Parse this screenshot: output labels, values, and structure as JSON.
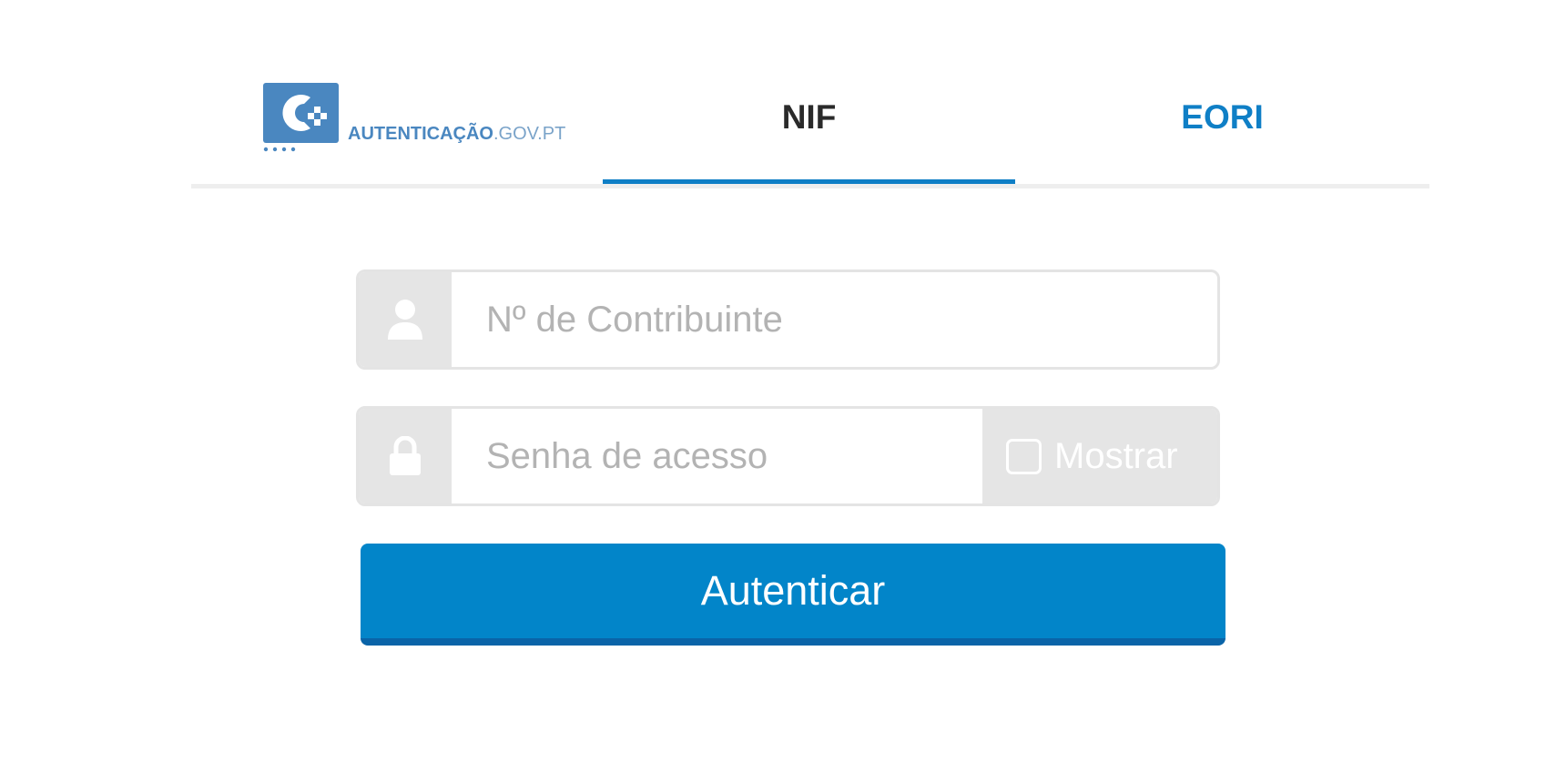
{
  "header": {
    "logo": {
      "brand_bold": "AUTENTICAÇÃO",
      "brand_thin": ".GOV.PT",
      "alt": "autenticacao-gov-logo"
    },
    "tabs": [
      {
        "label": "NIF",
        "active": true
      },
      {
        "label": "EORI",
        "active": false
      }
    ]
  },
  "form": {
    "nif_field": {
      "placeholder": "Nº de Contribuinte",
      "value": "",
      "icon": "user-icon"
    },
    "password_field": {
      "placeholder": "Senha de acesso",
      "value": "",
      "icon": "lock-icon"
    },
    "show_password": {
      "label": "Mostrar",
      "checked": false
    },
    "submit_label": "Autenticar"
  },
  "colors": {
    "accent": "#0f7fc6",
    "button": "#0285c9",
    "button_shadow": "#0a64a8",
    "logo_blue": "#4a87c0",
    "addon_gray": "#e5e5e5"
  }
}
